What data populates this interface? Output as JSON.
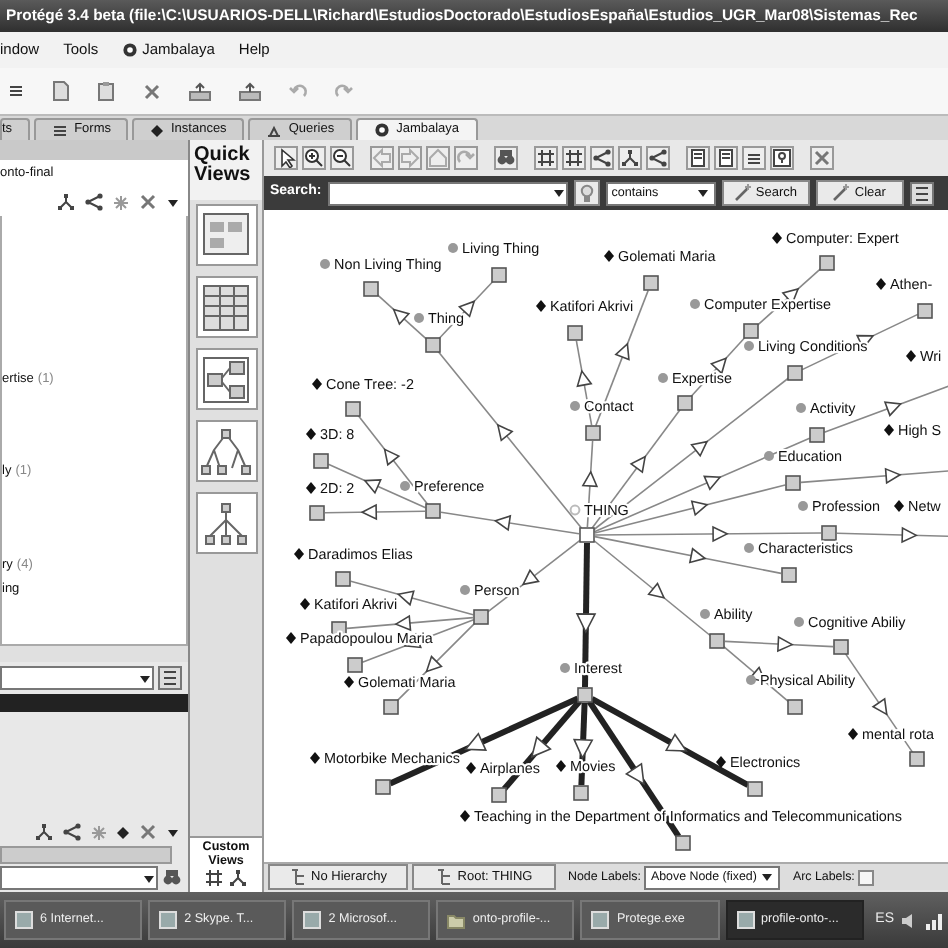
{
  "window": {
    "title": "Protégé 3.4 beta   (file:\\C:\\USUARIOS-DELL\\Richard\\EstudiosDoctorado\\EstudiosEspaña\\Estudios_UGR_Mar08\\Sistemas_Rec"
  },
  "menu": [
    "indow",
    "Tools",
    "Jambalaya",
    "Help"
  ],
  "tabs": [
    {
      "label": "ts",
      "selected": false
    },
    {
      "label": "Forms",
      "selected": false
    },
    {
      "label": "Instances",
      "selected": false
    },
    {
      "label": "Queries",
      "selected": false
    },
    {
      "label": "Jambalaya",
      "selected": true
    }
  ],
  "left_panel": {
    "project": "onto-final",
    "tree_items": [
      "ertise",
      "ly",
      "ry",
      "ing"
    ],
    "tree_counts": [
      "(1)",
      "(1)",
      "(4)"
    ]
  },
  "quick_views": {
    "title": "Quick Views",
    "custom_title": "Custom Views"
  },
  "search": {
    "label": "Search:",
    "match": "contains",
    "buttons": [
      "Search",
      "Clear"
    ]
  },
  "graph": {
    "root": {
      "label": "THING",
      "kind": "root",
      "children": [
        {
          "label": "Thing",
          "kind": "class",
          "children": [
            {
              "label": "Non Living Thing",
              "kind": "class"
            },
            {
              "label": "Living Thing",
              "kind": "class"
            }
          ]
        },
        {
          "label": "Contact",
          "kind": "class",
          "children": [
            {
              "label": "Katifori Akrivi",
              "kind": "instance"
            },
            {
              "label": "Golemati Maria",
              "kind": "instance"
            }
          ]
        },
        {
          "label": "Expertise",
          "kind": "class",
          "children": [
            {
              "label": "Computer Expertise",
              "kind": "class",
              "children": [
                {
                  "label": "Computer: Expert",
                  "kind": "instance"
                }
              ]
            }
          ]
        },
        {
          "label": "Living Conditions",
          "kind": "class",
          "children": [
            {
              "label": "Athen-",
              "kind": "instance"
            }
          ]
        },
        {
          "label": "Activity",
          "kind": "class",
          "children": [
            {
              "label": "Wri",
              "kind": "instance"
            }
          ]
        },
        {
          "label": "Education",
          "kind": "class",
          "children": [
            {
              "label": "High S",
              "kind": "instance"
            }
          ]
        },
        {
          "label": "Profession",
          "kind": "class",
          "children": [
            {
              "label": "Netw",
              "kind": "instance"
            }
          ]
        },
        {
          "label": "Characteristics",
          "kind": "class"
        },
        {
          "label": "Preference",
          "kind": "class",
          "children": [
            {
              "label": "Cone Tree: -2",
              "kind": "instance"
            },
            {
              "label": "3D: 8",
              "kind": "instance"
            },
            {
              "label": "2D: 2",
              "kind": "instance"
            }
          ]
        },
        {
          "label": "Person",
          "kind": "class",
          "children": [
            {
              "label": "Daradimos Elias",
              "kind": "instance"
            },
            {
              "label": "Katifori Akrivi",
              "kind": "instance"
            },
            {
              "label": "Papadopoulou Maria",
              "kind": "instance"
            },
            {
              "label": "Golemati Maria",
              "kind": "instance"
            }
          ]
        },
        {
          "label": "Ability",
          "kind": "class",
          "children": [
            {
              "label": "Cognitive Abiliy",
              "kind": "class",
              "children": [
                {
                  "label": "mental rota",
                  "kind": "instance"
                }
              ]
            },
            {
              "label": "Physical Ability",
              "kind": "class"
            }
          ]
        },
        {
          "label": "Interest",
          "kind": "class",
          "highlighted": true,
          "children": [
            {
              "label": "Motorbike Mechanics",
              "kind": "instance",
              "highlighted": true
            },
            {
              "label": "Airplanes",
              "kind": "instance",
              "highlighted": true
            },
            {
              "label": "Movies",
              "kind": "instance",
              "highlighted": true
            },
            {
              "label": "Electronics",
              "kind": "instance",
              "highlighted": true
            },
            {
              "label": "Teaching in the Department of Informatics and Telecommunications",
              "kind": "instance",
              "highlighted": true
            }
          ]
        }
      ]
    }
  },
  "bottom_bar": {
    "hierarchy_button": "No Hierarchy",
    "root_button": "Root: THING",
    "node_labels_label": "Node Labels:",
    "node_labels_value": "Above Node (fixed)",
    "arc_labels_label": "Arc Labels:",
    "arc_labels_checked": false
  },
  "taskbar": {
    "items": [
      {
        "label": "6 Internet...",
        "selected": false
      },
      {
        "label": "2 Skype. T...",
        "selected": false
      },
      {
        "label": "2 Microsof...",
        "selected": false
      },
      {
        "label": "onto-profile-...",
        "selected": false
      },
      {
        "label": "Protege.exe",
        "selected": false
      },
      {
        "label": "profile-onto-...",
        "selected": true
      }
    ],
    "language": "ES"
  }
}
